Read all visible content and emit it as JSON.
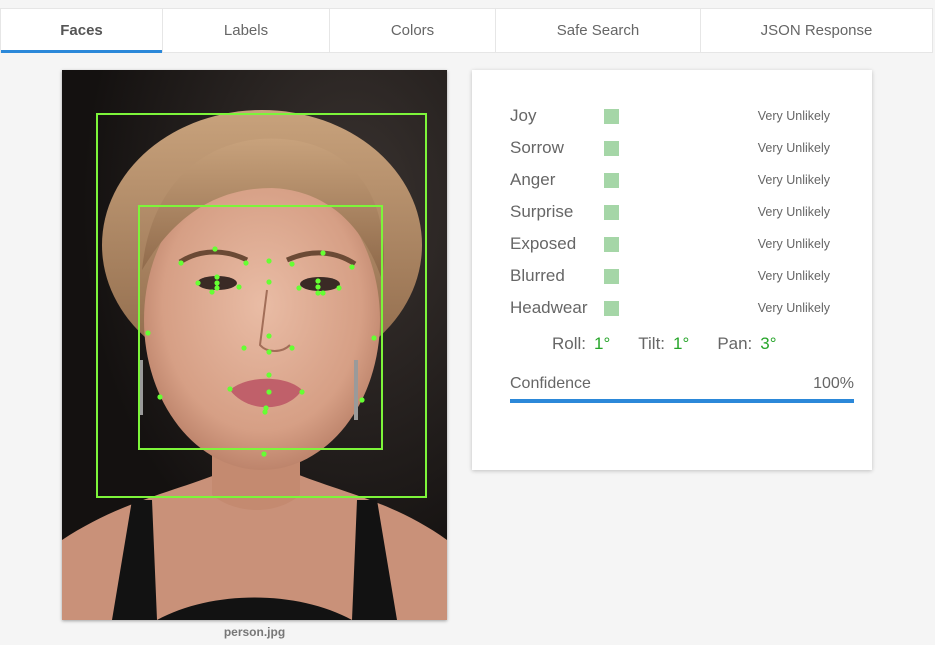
{
  "tabs": [
    {
      "label": "Faces",
      "active": true
    },
    {
      "label": "Labels",
      "active": false
    },
    {
      "label": "Colors",
      "active": false
    },
    {
      "label": "Safe Search",
      "active": false
    },
    {
      "label": "JSON Response",
      "active": false
    }
  ],
  "image": {
    "caption": "person.jpg"
  },
  "likelihoods": [
    {
      "name": "Joy",
      "value": "Very Unlikely"
    },
    {
      "name": "Sorrow",
      "value": "Very Unlikely"
    },
    {
      "name": "Anger",
      "value": "Very Unlikely"
    },
    {
      "name": "Surprise",
      "value": "Very Unlikely"
    },
    {
      "name": "Exposed",
      "value": "Very Unlikely"
    },
    {
      "name": "Blurred",
      "value": "Very Unlikely"
    },
    {
      "name": "Headwear",
      "value": "Very Unlikely"
    }
  ],
  "angles": {
    "roll_label": "Roll:",
    "roll": "1°",
    "tilt_label": "Tilt:",
    "tilt": "1°",
    "pan_label": "Pan:",
    "pan": "3°"
  },
  "confidence": {
    "label": "Confidence",
    "value": "100%",
    "fraction": 1.0
  },
  "colors": {
    "accent": "#2b88d9",
    "box": "#7df53a",
    "landmark": "#66ff33",
    "likelihood_swatch": "#a5d6a7",
    "angle_value": "#27a52a"
  }
}
